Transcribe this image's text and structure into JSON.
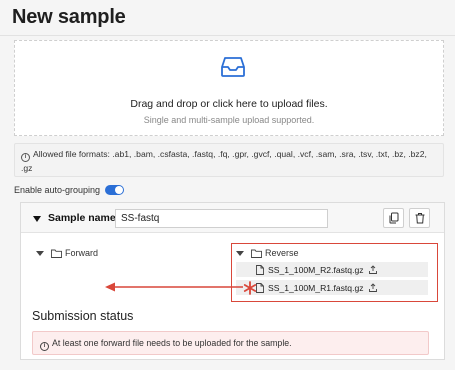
{
  "header": {
    "title": "New sample"
  },
  "upload": {
    "main_text": "Drag and drop or click here to upload files.",
    "sub_text": "Single and multi-sample upload supported.",
    "icon": "inbox-icon"
  },
  "formats": {
    "text": "Allowed file formats: .ab1, .bam, .csfasta, .fastq, .fq, .gpr, .gvcf, .qual, .vcf, .sam, .sra, .tsv, .txt, .bz, .bz2, .gz"
  },
  "auto_grouping": {
    "label": "Enable auto-grouping",
    "enabled": true
  },
  "sample": {
    "label": "Sample name:",
    "value": "SS-fastq",
    "forward": {
      "label": "Forward"
    },
    "reverse": {
      "label": "Reverse",
      "files": [
        "SS_1_100M_R2.fastq.gz",
        "SS_1_100M_R1.fastq.gz"
      ]
    }
  },
  "status": {
    "title": "Submission status",
    "alert": "At least one forward file needs to be uploaded for the sample."
  },
  "colors": {
    "accent": "#2b6fd6",
    "annotation_red": "#d9473a",
    "alert_bg": "#fdeeee"
  }
}
